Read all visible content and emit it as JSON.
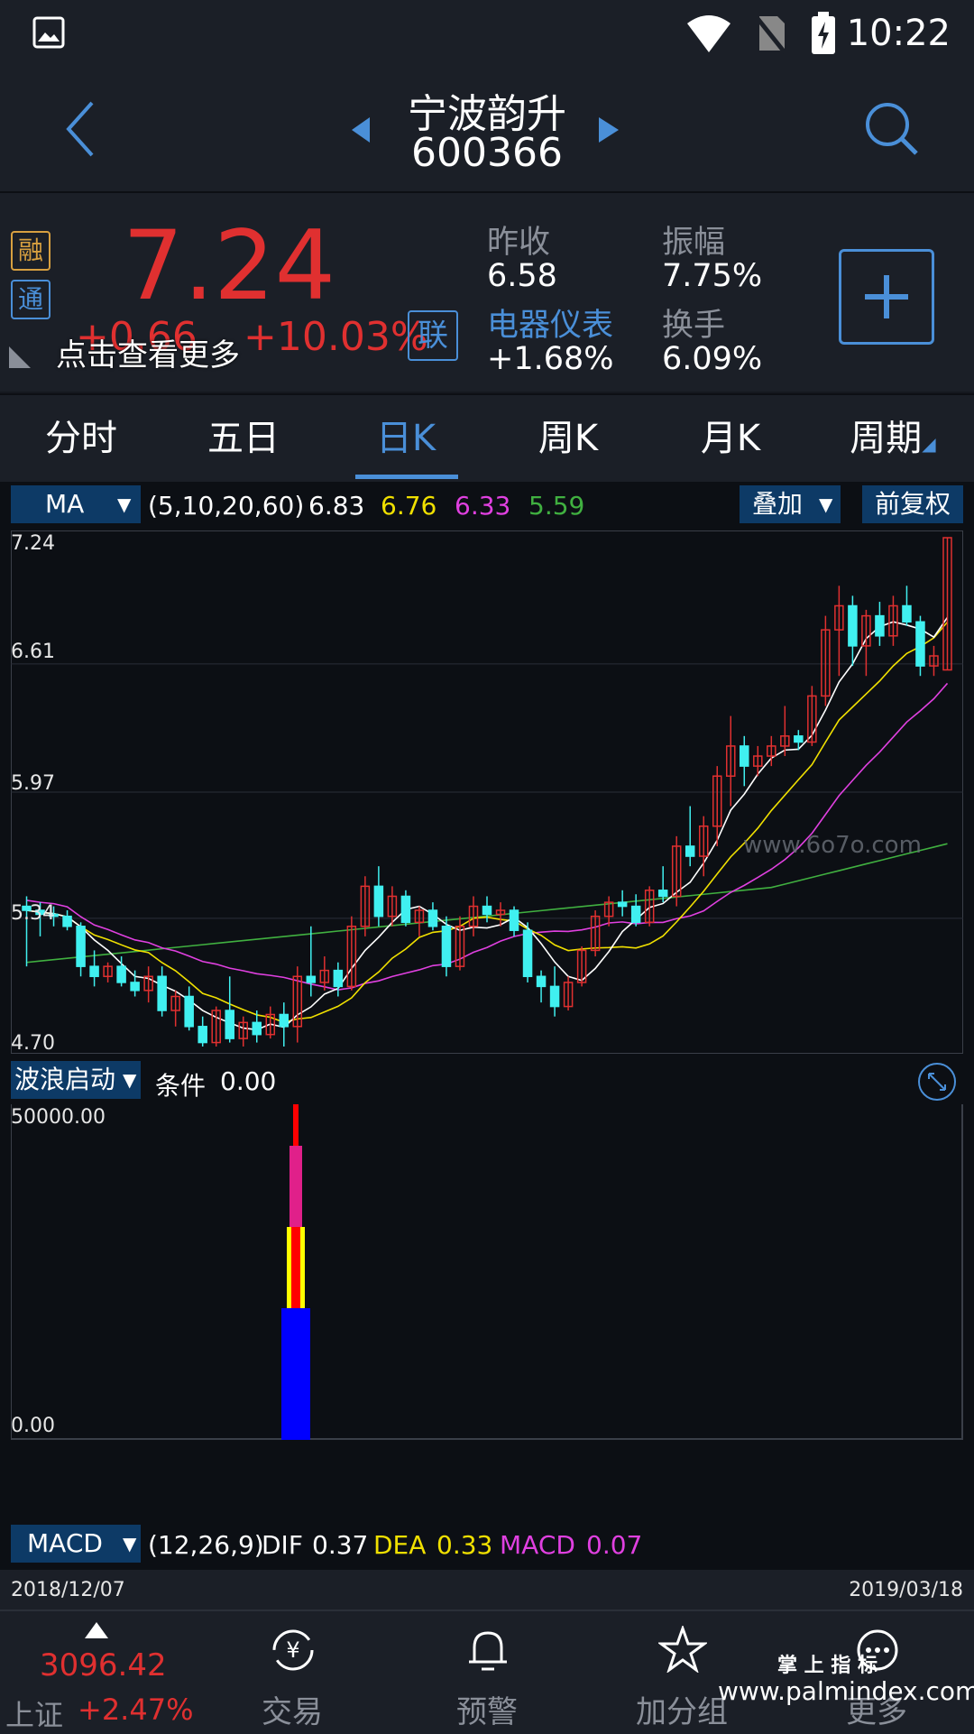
{
  "status": {
    "time": "10:22"
  },
  "header": {
    "stock_name": "宁波韵升",
    "stock_code": "600366"
  },
  "quote": {
    "tag_rong": "融",
    "tag_tong": "通",
    "price": "7.24",
    "change": "+0.66",
    "change_pct": "+10.03%",
    "link_badge": "联",
    "more_hint": "点击查看更多",
    "prev_close_label": "昨收",
    "prev_close": "6.58",
    "amplitude_label": "振幅",
    "amplitude": "7.75%",
    "sector_name": "电器仪表",
    "sector_change": "+1.68%",
    "turnover_label": "换手",
    "turnover": "6.09%",
    "colors": {
      "up": "#e03030",
      "accent": "#4a8fd8"
    }
  },
  "tabs": [
    "分时",
    "五日",
    "日K",
    "周K",
    "月K",
    "周期"
  ],
  "active_tab": 2,
  "ma": {
    "selector": "MA",
    "params": "(5,10,20,60)",
    "v5": "6.83",
    "v10": "6.76",
    "v20": "6.33",
    "v60": "5.59",
    "overlay_btn": "叠加",
    "adjust_btn": "前复权",
    "axis": [
      "7.24",
      "6.61",
      "5.97",
      "5.34",
      "4.70"
    ],
    "colors": {
      "ma5": "#ffffff",
      "ma10": "#f0e000",
      "ma20": "#e040e0",
      "ma60": "#40b040",
      "up": "#e03030",
      "down": "#40f0f0"
    }
  },
  "indicator": {
    "selector": "波浪启动",
    "label": "条件",
    "value": "0.00",
    "axis_top": "50000.00",
    "axis_bottom": "0.00"
  },
  "macd": {
    "selector": "MACD",
    "params": "(12,26,9)",
    "dif_label": "DIF",
    "dif": "0.37",
    "dea_label": "DEA",
    "dea": "0.33",
    "macd_label": "MACD",
    "macd_value": "0.07"
  },
  "dates": {
    "start": "2018/12/07",
    "end": "2019/03/18"
  },
  "watermark": {
    "top": "www.6o7o.com",
    "bottom_cn": "掌 上 指 标",
    "bottom_url": "www.palmindex.com"
  },
  "bottom_nav": {
    "index_value": "3096.42",
    "index_name": "上证",
    "index_change": "+2.47%",
    "items": [
      "交易",
      "预警",
      "加分组",
      "更多"
    ]
  },
  "chart_data": {
    "type": "candlestick",
    "ylim": [
      4.7,
      7.24
    ],
    "ma_labels": [
      "MA5",
      "MA10",
      "MA20",
      "MA60"
    ],
    "candles": [
      [
        5.4,
        5.45,
        5.1,
        5.38
      ],
      [
        5.38,
        5.42,
        5.25,
        5.36
      ],
      [
        5.36,
        5.4,
        5.3,
        5.35
      ],
      [
        5.35,
        5.38,
        5.28,
        5.3
      ],
      [
        5.3,
        5.32,
        5.05,
        5.1
      ],
      [
        5.1,
        5.18,
        5.0,
        5.05
      ],
      [
        5.05,
        5.12,
        5.02,
        5.1
      ],
      [
        5.1,
        5.15,
        5.0,
        5.02
      ],
      [
        5.02,
        5.08,
        4.95,
        4.98
      ],
      [
        4.98,
        5.1,
        4.92,
        5.05
      ],
      [
        5.05,
        5.1,
        4.85,
        4.88
      ],
      [
        4.88,
        4.98,
        4.8,
        4.95
      ],
      [
        4.95,
        5.0,
        4.78,
        4.8
      ],
      [
        4.8,
        4.85,
        4.7,
        4.72
      ],
      [
        4.72,
        4.9,
        4.7,
        4.88
      ],
      [
        4.88,
        5.05,
        4.72,
        4.74
      ],
      [
        4.74,
        4.85,
        4.7,
        4.82
      ],
      [
        4.82,
        4.88,
        4.72,
        4.76
      ],
      [
        4.76,
        4.9,
        4.74,
        4.86
      ],
      [
        4.86,
        4.92,
        4.7,
        4.8
      ],
      [
        4.8,
        5.1,
        4.72,
        5.05
      ],
      [
        5.05,
        5.3,
        4.95,
        5.02
      ],
      [
        5.02,
        5.15,
        4.98,
        5.08
      ],
      [
        5.08,
        5.12,
        4.95,
        5.0
      ],
      [
        5.0,
        5.35,
        4.98,
        5.3
      ],
      [
        5.3,
        5.55,
        5.25,
        5.5
      ],
      [
        5.5,
        5.6,
        5.3,
        5.35
      ],
      [
        5.35,
        5.5,
        5.3,
        5.45
      ],
      [
        5.45,
        5.48,
        5.3,
        5.32
      ],
      [
        5.32,
        5.4,
        5.25,
        5.38
      ],
      [
        5.38,
        5.42,
        5.28,
        5.3
      ],
      [
        5.3,
        5.35,
        5.05,
        5.1
      ],
      [
        5.1,
        5.35,
        5.08,
        5.3
      ],
      [
        5.3,
        5.45,
        5.25,
        5.4
      ],
      [
        5.4,
        5.45,
        5.32,
        5.36
      ],
      [
        5.36,
        5.42,
        5.3,
        5.38
      ],
      [
        5.38,
        5.4,
        5.25,
        5.28
      ],
      [
        5.28,
        5.32,
        5.02,
        5.05
      ],
      [
        5.05,
        5.08,
        4.92,
        5.0
      ],
      [
        5.0,
        5.1,
        4.85,
        4.9
      ],
      [
        4.9,
        5.05,
        4.88,
        5.02
      ],
      [
        5.02,
        5.2,
        5.0,
        5.18
      ],
      [
        5.18,
        5.38,
        5.15,
        5.35
      ],
      [
        5.35,
        5.45,
        5.3,
        5.42
      ],
      [
        5.42,
        5.48,
        5.35,
        5.4
      ],
      [
        5.4,
        5.46,
        5.3,
        5.32
      ],
      [
        5.32,
        5.5,
        5.3,
        5.48
      ],
      [
        5.48,
        5.6,
        5.42,
        5.45
      ],
      [
        5.45,
        5.75,
        5.4,
        5.7
      ],
      [
        5.7,
        5.9,
        5.6,
        5.65
      ],
      [
        5.65,
        5.85,
        5.55,
        5.8
      ],
      [
        5.8,
        6.1,
        5.7,
        6.05
      ],
      [
        6.05,
        6.35,
        5.9,
        6.2
      ],
      [
        6.2,
        6.25,
        6.0,
        6.1
      ],
      [
        6.1,
        6.2,
        6.05,
        6.15
      ],
      [
        6.15,
        6.25,
        6.1,
        6.2
      ],
      [
        6.2,
        6.4,
        6.15,
        6.25
      ],
      [
        6.25,
        6.28,
        6.18,
        6.22
      ],
      [
        6.22,
        6.5,
        6.2,
        6.45
      ],
      [
        6.45,
        6.85,
        6.4,
        6.78
      ],
      [
        6.78,
        7.0,
        6.55,
        6.9
      ],
      [
        6.9,
        6.95,
        6.6,
        6.7
      ],
      [
        6.7,
        6.88,
        6.55,
        6.85
      ],
      [
        6.85,
        6.92,
        6.7,
        6.75
      ],
      [
        6.75,
        6.95,
        6.7,
        6.9
      ],
      [
        6.9,
        7.0,
        6.8,
        6.82
      ],
      [
        6.82,
        6.85,
        6.55,
        6.6
      ],
      [
        6.6,
        6.7,
        6.55,
        6.65
      ],
      [
        6.58,
        7.24,
        6.58,
        7.24
      ]
    ]
  }
}
